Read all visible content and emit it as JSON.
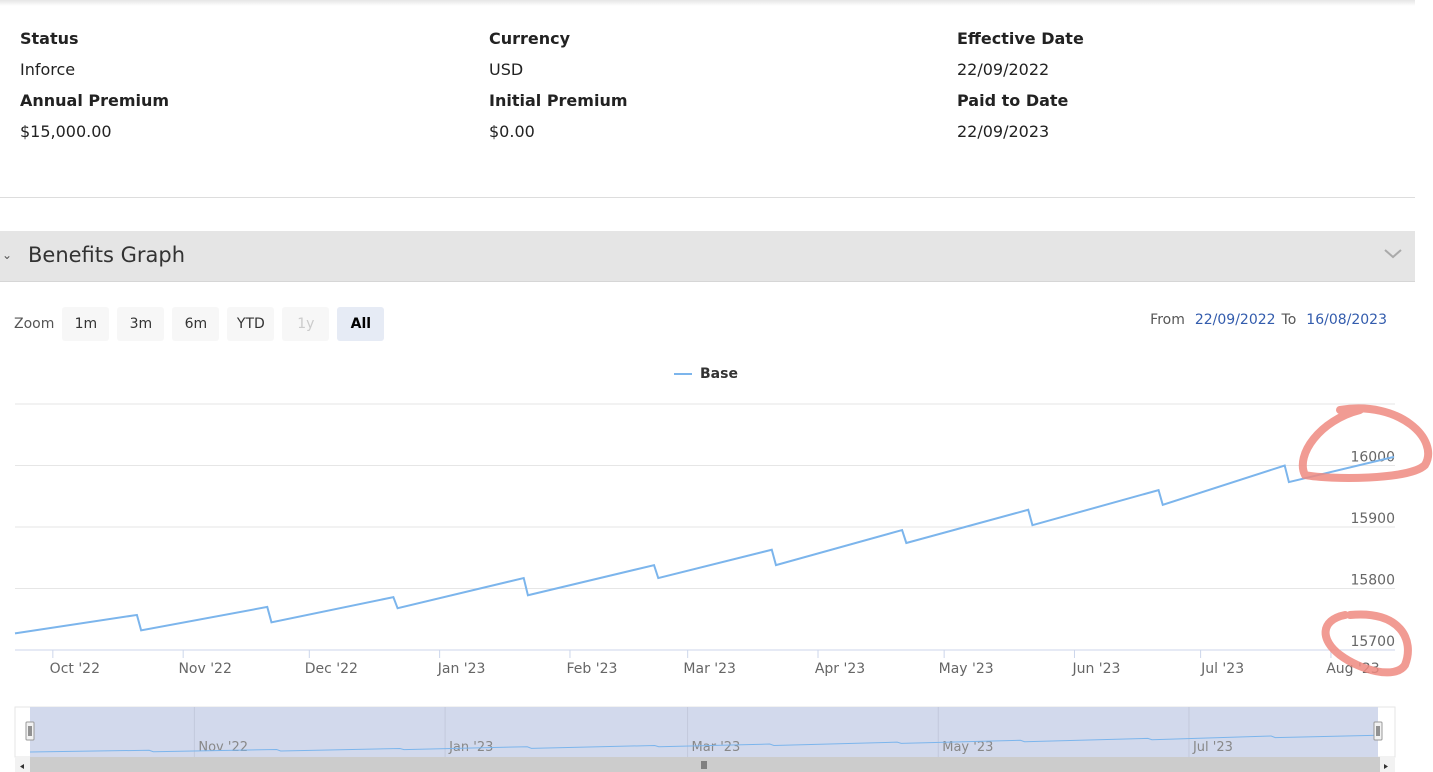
{
  "policy_info": [
    {
      "label": "Status",
      "value": "Inforce"
    },
    {
      "label": "Annual Premium",
      "value": "$15,000.00"
    },
    {
      "label": "Currency",
      "value": "USD"
    },
    {
      "label": "Initial Premium",
      "value": "$0.00"
    },
    {
      "label": "Effective Date",
      "value": "22/09/2022"
    },
    {
      "label": "Paid to Date",
      "value": "22/09/2023"
    }
  ],
  "section": {
    "title": "Benefits Graph"
  },
  "zoom": {
    "label": "Zoom",
    "buttons": [
      {
        "label": "1m",
        "state": "normal"
      },
      {
        "label": "3m",
        "state": "normal"
      },
      {
        "label": "6m",
        "state": "normal"
      },
      {
        "label": "YTD",
        "state": "normal"
      },
      {
        "label": "1y",
        "state": "disabled"
      },
      {
        "label": "All",
        "state": "selected"
      }
    ]
  },
  "range": {
    "from_label": "From",
    "from": "22/09/2022",
    "to_label": "To",
    "to": "16/08/2023"
  },
  "colors": {
    "series": "#7cb5ec",
    "navigator_fill": "#d2d9ec",
    "annotation": "#ee8a80"
  },
  "chart_data": {
    "type": "line",
    "legend": {
      "entries": [
        "Base"
      ],
      "placement": "top-center"
    },
    "grid": true,
    "ylim": [
      15700,
      16100
    ],
    "yticks": [
      15700,
      15800,
      15900,
      16000
    ],
    "xlim": [
      "2022-09-22",
      "2023-08-16"
    ],
    "xticks": [
      {
        "date": "2022-10-01",
        "label": "Oct '22"
      },
      {
        "date": "2022-11-01",
        "label": "Nov '22"
      },
      {
        "date": "2022-12-01",
        "label": "Dec '22"
      },
      {
        "date": "2023-01-01",
        "label": "Jan '23"
      },
      {
        "date": "2023-02-01",
        "label": "Feb '23"
      },
      {
        "date": "2023-03-01",
        "label": "Mar '23"
      },
      {
        "date": "2023-04-01",
        "label": "Apr '23"
      },
      {
        "date": "2023-05-01",
        "label": "May '23"
      },
      {
        "date": "2023-06-01",
        "label": "Jun '23"
      },
      {
        "date": "2023-07-01",
        "label": "Jul '23"
      },
      {
        "date": "2023-08-01",
        "label": "Aug '23"
      }
    ],
    "navigator_ticks": [
      {
        "date": "2022-11-01",
        "label": "Nov '22"
      },
      {
        "date": "2023-01-01",
        "label": "Jan '23"
      },
      {
        "date": "2023-03-01",
        "label": "Mar '23"
      },
      {
        "date": "2023-05-01",
        "label": "May '23"
      },
      {
        "date": "2023-07-01",
        "label": "Jul '23"
      }
    ],
    "series": [
      {
        "name": "Base",
        "points": [
          [
            "2022-09-22",
            15727
          ],
          [
            "2022-10-21",
            15757
          ],
          [
            "2022-10-22",
            15732
          ],
          [
            "2022-11-21",
            15770
          ],
          [
            "2022-11-22",
            15745
          ],
          [
            "2022-12-21",
            15786
          ],
          [
            "2022-12-22",
            15768
          ],
          [
            "2023-01-21",
            15817
          ],
          [
            "2023-01-22",
            15789
          ],
          [
            "2023-02-21",
            15838
          ],
          [
            "2023-02-22",
            15817
          ],
          [
            "2023-03-21",
            15863
          ],
          [
            "2023-03-22",
            15838
          ],
          [
            "2023-04-21",
            15895
          ],
          [
            "2023-04-22",
            15874
          ],
          [
            "2023-05-21",
            15928
          ],
          [
            "2023-05-22",
            15903
          ],
          [
            "2023-06-21",
            15960
          ],
          [
            "2023-06-22",
            15936
          ],
          [
            "2023-07-21",
            16000
          ],
          [
            "2023-07-22",
            15973
          ],
          [
            "2023-08-16",
            16014
          ]
        ]
      }
    ]
  }
}
